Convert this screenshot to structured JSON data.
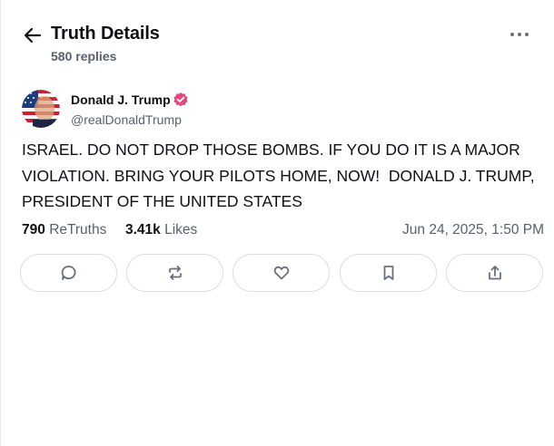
{
  "header": {
    "title": "Truth Details",
    "reply_count": "580 replies",
    "back_icon": "arrow-left-icon",
    "more_icon": "more-horizontal-icon"
  },
  "post": {
    "author": {
      "name": "Donald J. Trump",
      "handle": "@realDonaldTrump",
      "verified": true,
      "verified_color": "#e2497d"
    },
    "text": "ISRAEL. DO NOT DROP THOSE BOMBS. IF YOU DO IT IS A MAJOR VIOLATION. BRING YOUR PILOTS HOME, NOW!  DONALD J. TRUMP, PRESIDENT OF THE UNITED STATES",
    "stats": {
      "retruths_count": "790",
      "retruths_label": "ReTruths",
      "likes_count": "3.41k",
      "likes_label": "Likes"
    },
    "timestamp": "Jun 24, 2025, 1:50 PM"
  },
  "actions": [
    {
      "name": "reply",
      "icon": "reply-bubble-icon"
    },
    {
      "name": "retruth",
      "icon": "retruth-arrows-icon"
    },
    {
      "name": "like",
      "icon": "heart-icon"
    },
    {
      "name": "bookmark",
      "icon": "bookmark-icon"
    },
    {
      "name": "share",
      "icon": "share-icon"
    }
  ],
  "colors": {
    "text": "#0f0f14",
    "muted": "#5b5f6b",
    "border": "#dcdde3",
    "icon": "#6b6f7b"
  }
}
